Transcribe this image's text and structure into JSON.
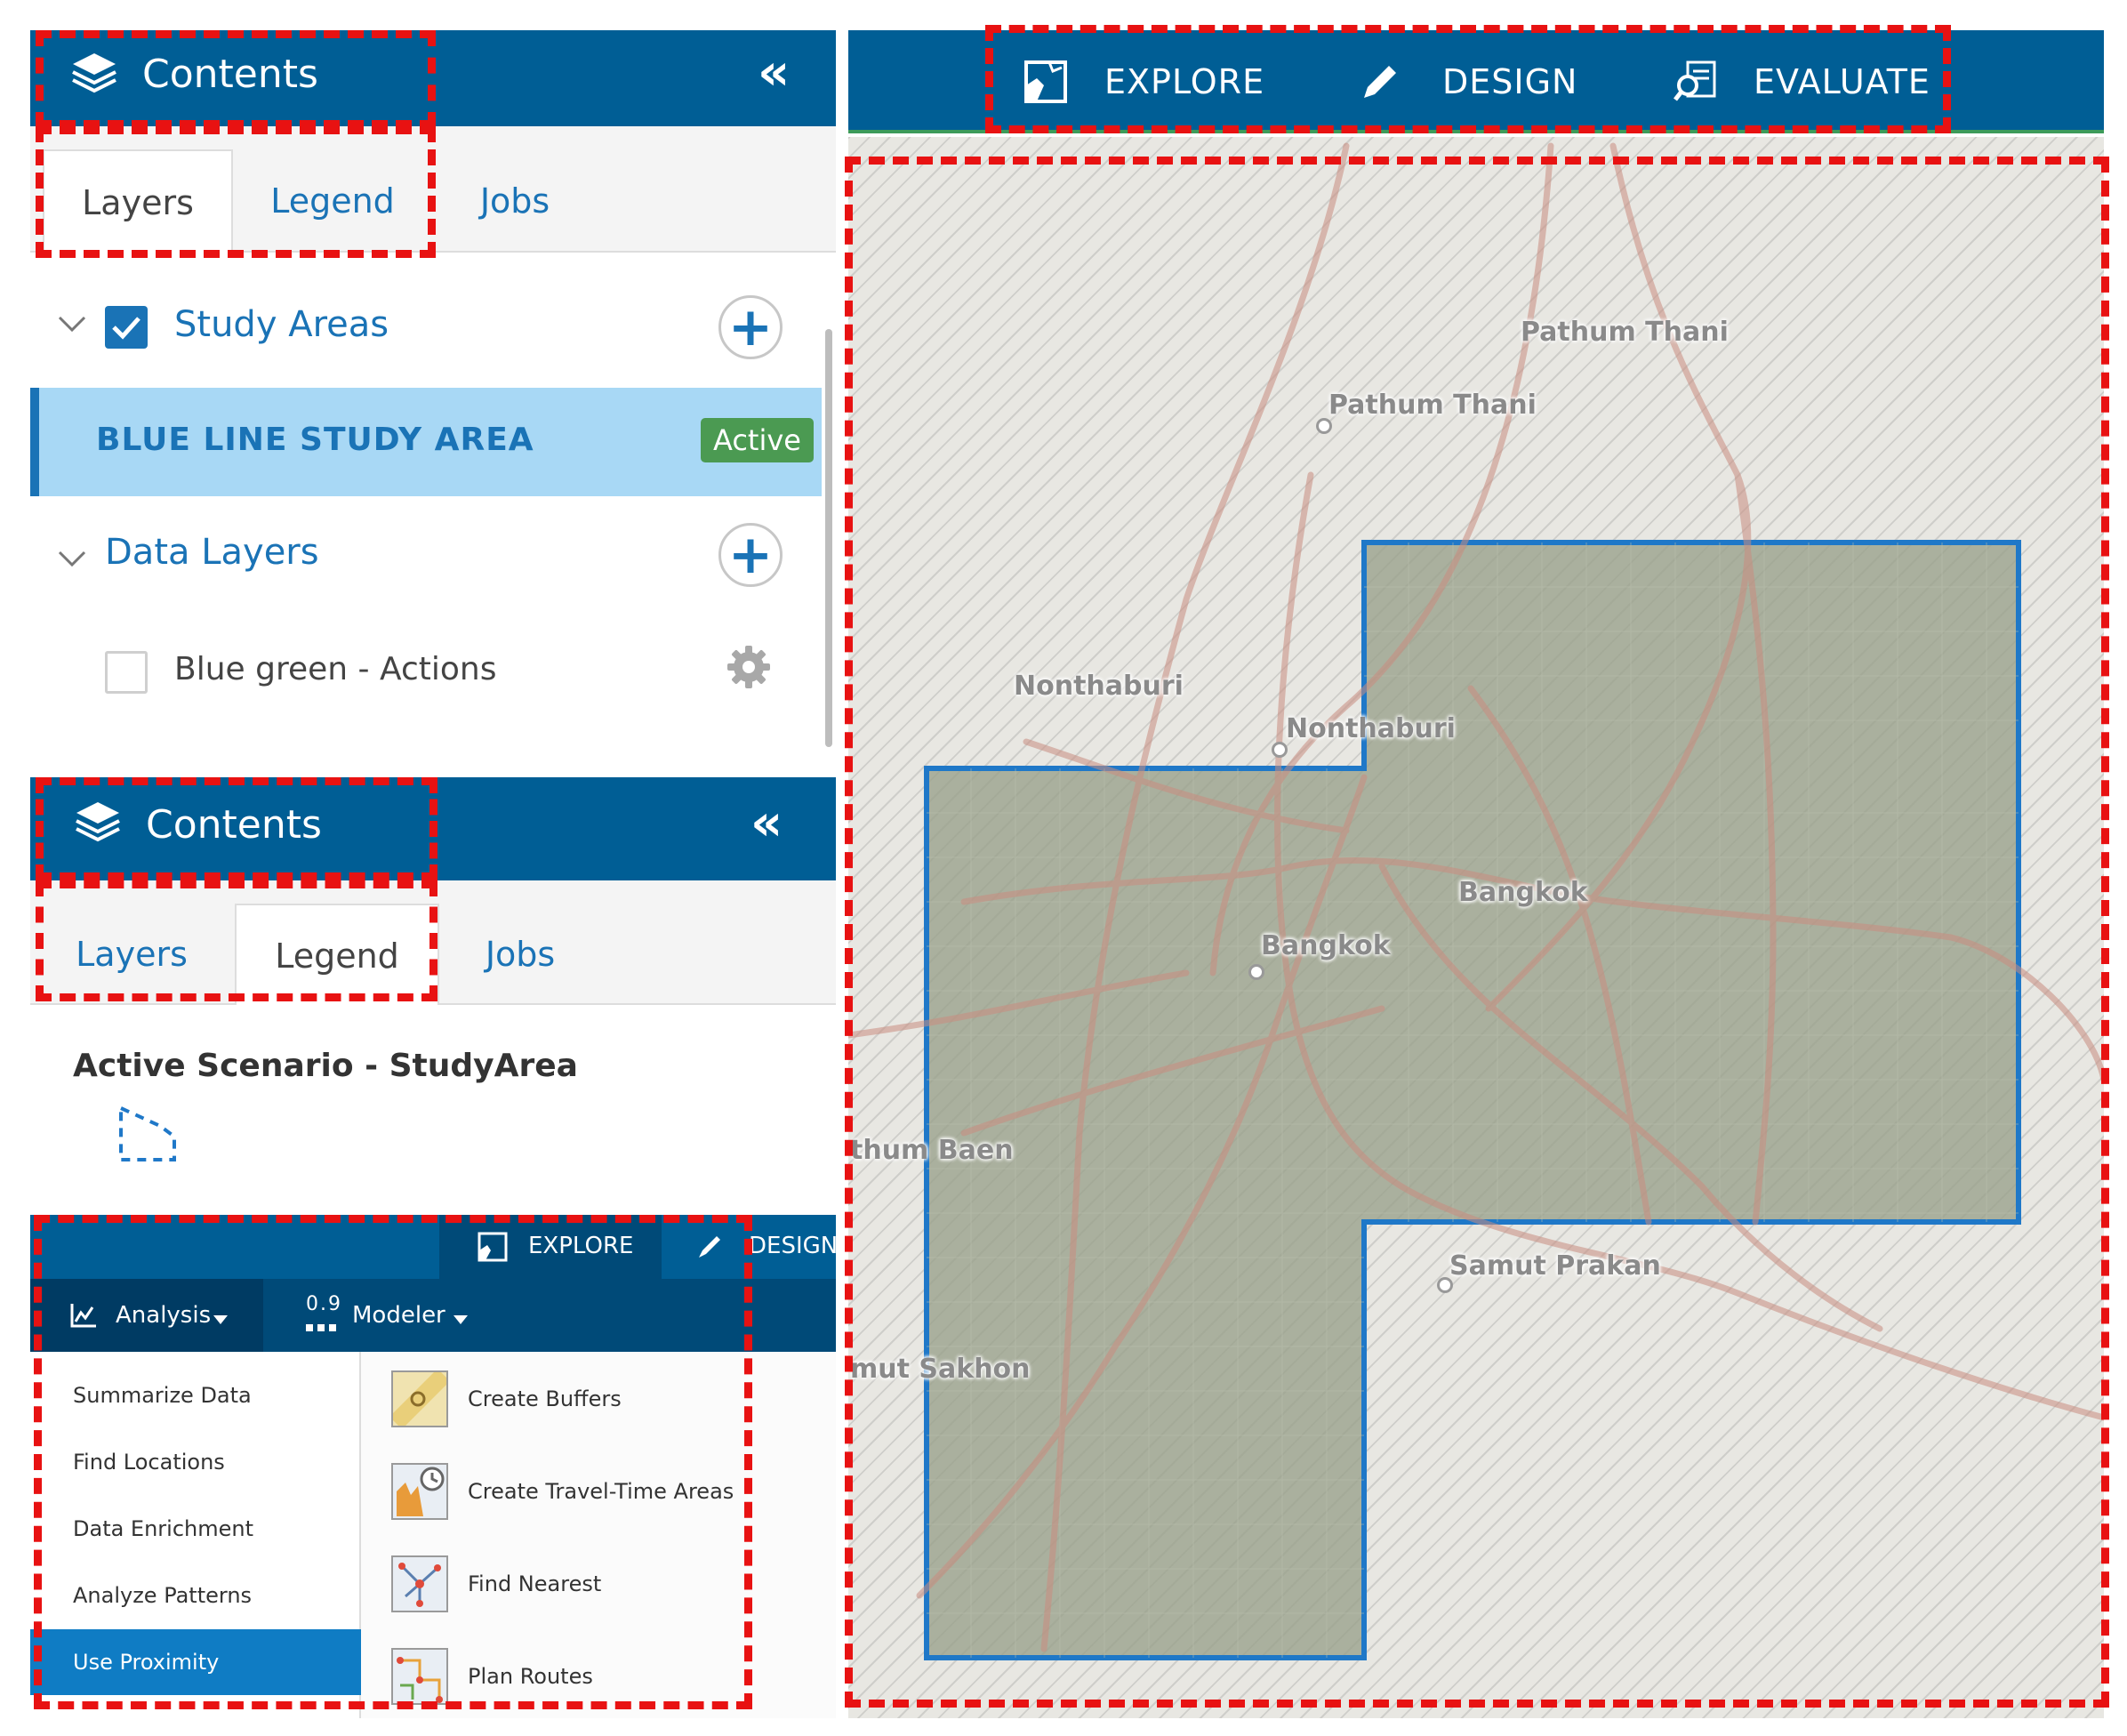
{
  "panel1": {
    "header_title": "Contents",
    "collapse_glyph": "«",
    "tabs": [
      {
        "label": "Layers",
        "active": true
      },
      {
        "label": "Legend",
        "active": false
      },
      {
        "label": "Jobs",
        "active": false
      }
    ],
    "study_areas": {
      "label": "Study Areas",
      "checked": true,
      "item": {
        "label": "BLUE LINE STUDY AREA",
        "badge": "Active"
      }
    },
    "data_layers": {
      "label": "Data Layers",
      "item": {
        "label": "Blue green - Actions",
        "checked": false
      }
    }
  },
  "panel2": {
    "header_title": "Contents",
    "collapse_glyph": "«",
    "tabs": [
      {
        "label": "Layers",
        "active": false
      },
      {
        "label": "Legend",
        "active": true
      },
      {
        "label": "Jobs",
        "active": false
      }
    ],
    "legend_title": "Active Scenario - StudyArea"
  },
  "panel3": {
    "top_tabs": [
      "EXPLORE",
      "DESIGN"
    ],
    "menus": [
      "Analysis",
      "Modeler"
    ],
    "modeler_prefix": "0.9",
    "categories": [
      "Summarize Data",
      "Find Locations",
      "Data Enrichment",
      "Analyze Patterns",
      "Use Proximity"
    ],
    "selected_category": "Use Proximity",
    "tools": [
      "Create Buffers",
      "Create Travel-Time Areas",
      "Find Nearest",
      "Plan Routes"
    ]
  },
  "map": {
    "nav": [
      "EXPLORE",
      "DESIGN",
      "EVALUATE"
    ],
    "places": [
      "Pathum Thani",
      "Pathum Thani",
      "Nonthaburi",
      "Nonthaburi",
      "Bangkok",
      "Bangkok",
      "thum Baen",
      "Samut Prakan",
      "mut Sakhon"
    ]
  },
  "colors": {
    "header_blue": "#005e95",
    "accent_blue": "#1a73b6",
    "active_row": "#a8d8f5",
    "active_badge": "#4b9a52",
    "annotation_red": "#e81212",
    "study_area_outline": "#1f78c8"
  }
}
